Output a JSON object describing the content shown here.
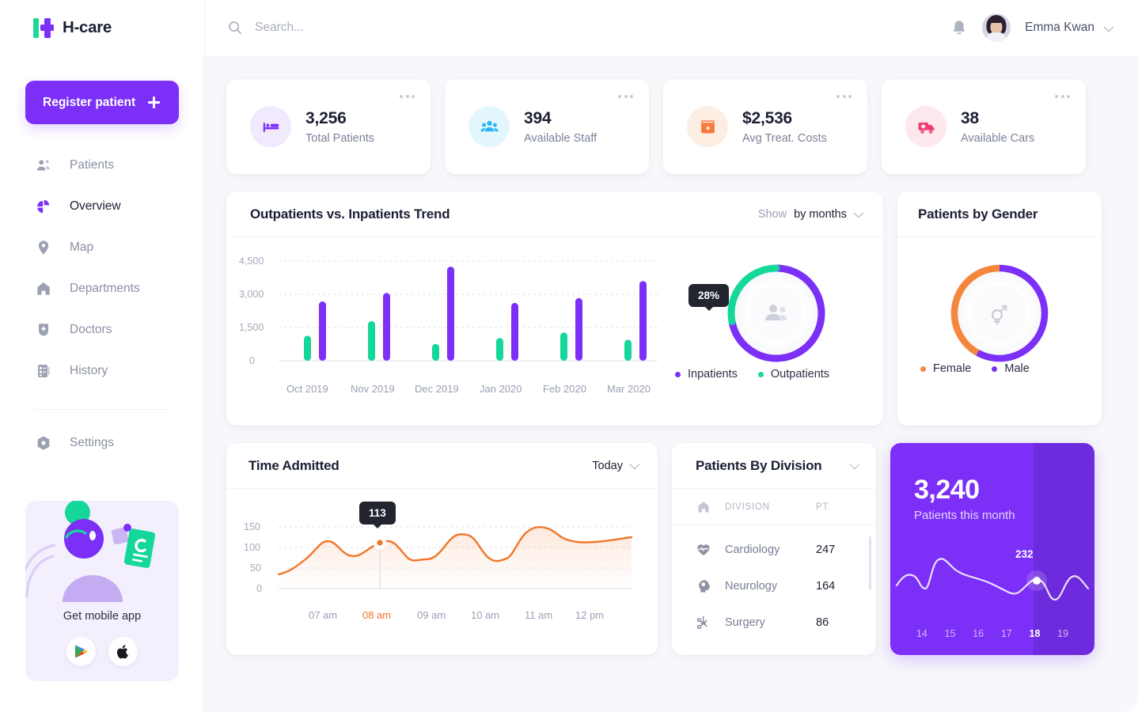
{
  "brand": {
    "name": "H-care",
    "logo_icon": "hcare-logo-icon"
  },
  "search": {
    "placeholder": "Search...",
    "value": "",
    "icon": "search-icon"
  },
  "header": {
    "notification_icon": "bell-icon",
    "user_name": "Emma Kwan",
    "avatar_icon": "user-avatar",
    "chevron_icon": "chevron-down-icon"
  },
  "sidebar": {
    "register_label": "Register patient",
    "register_icon": "plus-icon",
    "items": [
      {
        "label": "Patients",
        "icon": "people-icon",
        "active": false
      },
      {
        "label": "Overview",
        "icon": "pie-chart-icon",
        "active": true
      },
      {
        "label": "Map",
        "icon": "location-pin-icon",
        "active": false
      },
      {
        "label": "Departments",
        "icon": "home-icon",
        "active": false
      },
      {
        "label": "Doctors",
        "icon": "doctor-badge-icon",
        "active": false
      },
      {
        "label": "History",
        "icon": "history-list-icon",
        "active": false
      }
    ],
    "settings": {
      "label": "Settings",
      "icon": "settings-gear-icon"
    },
    "promo": {
      "title": "Get mobile app",
      "google_play_icon": "google-play-icon",
      "apple_icon": "apple-icon"
    }
  },
  "stats": [
    {
      "value": "3,256",
      "label": "Total Patients",
      "icon": "hospital-bed-icon",
      "icon_color": "#7B2FF7",
      "bg_color": "#f1e9fe",
      "menu_icon": "more-icon"
    },
    {
      "value": "394",
      "label": "Available Staff",
      "icon": "group-people-icon",
      "icon_color": "#29B6F6",
      "bg_color": "#e4f6fd",
      "menu_icon": "more-icon"
    },
    {
      "value": "$2,536",
      "label": "Avg Treat. Costs",
      "icon": "wallet-icon",
      "icon_color": "#F97A3D",
      "bg_color": "#fdeee3",
      "menu_icon": "more-icon"
    },
    {
      "value": "38",
      "label": "Available Cars",
      "icon": "ambulance-icon",
      "icon_color": "#F23E6E",
      "bg_color": "#fde8ee",
      "menu_icon": "more-icon"
    }
  ],
  "trend": {
    "title": "Outpatients vs. Inpatients Trend",
    "filter_muted": "Show",
    "filter_strong": "by months",
    "filter_icon": "chevron-down-icon",
    "donut_label": "28%",
    "donut_center_icon": "people-icon",
    "legend": [
      {
        "label": "Inpatients",
        "color": "#7B2FF7"
      },
      {
        "label": "Outpatients",
        "color": "#16D79A"
      }
    ]
  },
  "gender": {
    "title": "Patients by Gender",
    "center_icon": "gender-symbol-icon",
    "legend": [
      {
        "label": "Female",
        "color": "#F5873C"
      },
      {
        "label": "Male",
        "color": "#7B2FF7"
      }
    ]
  },
  "time_admitted": {
    "title": "Time Admitted",
    "filter_label": "Today",
    "filter_icon": "chevron-down-icon",
    "tooltip": "113"
  },
  "division": {
    "title": "Patients By Division",
    "collapse_icon": "chevron-down-icon",
    "header_icon": "home-icon",
    "columns": [
      "DIVISION",
      "PT."
    ],
    "rows": [
      {
        "name": "Cardiology",
        "pt": "247",
        "icon": "heart-pulse-icon"
      },
      {
        "name": "Neurology",
        "pt": "164",
        "icon": "brain-head-icon"
      },
      {
        "name": "Surgery",
        "pt": "86",
        "icon": "scissors-icon"
      }
    ]
  },
  "month_card": {
    "value": "3,240",
    "label": "Patients this month",
    "tooltip": "232",
    "days": [
      "14",
      "15",
      "16",
      "17",
      "18",
      "19"
    ],
    "active_day": "18",
    "bg_color": "#7B2FF7"
  },
  "chart_data": [
    {
      "type": "bar",
      "title": "Outpatients vs. Inpatients Trend",
      "categories": [
        "Oct 2019",
        "Nov 2019",
        "Dec 2019",
        "Jan 2020",
        "Feb 2020",
        "Mar 2020"
      ],
      "series": [
        {
          "name": "Outpatients",
          "color": "#16D79A",
          "values": [
            1130,
            1790,
            760,
            1030,
            1280,
            950
          ]
        },
        {
          "name": "Inpatients",
          "color": "#7B2FF7",
          "values": [
            2680,
            3060,
            4250,
            2610,
            2830,
            3600
          ]
        }
      ],
      "yticks": [
        "0",
        "1,500",
        "3,000",
        "4,500"
      ],
      "ylim": [
        0,
        4500
      ],
      "xlabel": "",
      "ylabel": "",
      "grid": true,
      "legend_position": "bottom"
    },
    {
      "type": "pie",
      "title": "Outpatients vs. Inpatients share",
      "labels": [
        "Inpatients",
        "Outpatients"
      ],
      "values": [
        72,
        28
      ],
      "colors": [
        "#7B2FF7",
        "#16D79A"
      ],
      "annotation": "28%",
      "legend_position": "bottom"
    },
    {
      "type": "pie",
      "title": "Patients by Gender",
      "labels": [
        "Female",
        "Male"
      ],
      "values": [
        42,
        58
      ],
      "colors": [
        "#F5873C",
        "#7B2FF7"
      ],
      "legend_position": "bottom"
    },
    {
      "type": "area",
      "title": "Time Admitted",
      "x": [
        "07 am",
        "08 am",
        "09 am",
        "10 am",
        "11 am",
        "12 pm"
      ],
      "series": [
        {
          "name": "Admitted",
          "color": "#F2752A",
          "values": [
            110,
            113,
            70,
            132,
            143,
            120
          ]
        }
      ],
      "yticks": [
        "0",
        "50",
        "100",
        "150"
      ],
      "ylim": [
        0,
        175
      ],
      "annotation": "113",
      "highlight_x": "08 am",
      "grid": true,
      "legend_position": "none"
    },
    {
      "type": "line",
      "title": "Patients this month",
      "x": [
        "14",
        "15",
        "16",
        "17",
        "18",
        "19"
      ],
      "series": [
        {
          "name": "Patients",
          "color": "#FFFFFF",
          "values": [
            218,
            255,
            240,
            205,
            232,
            245
          ]
        }
      ],
      "annotation": "232",
      "highlight_x": "18",
      "grid": false,
      "legend_position": "none"
    },
    {
      "type": "table",
      "title": "Patients By Division",
      "columns": [
        "DIVISION",
        "PT."
      ],
      "rows": [
        [
          "Cardiology",
          "247"
        ],
        [
          "Neurology",
          "164"
        ],
        [
          "Surgery",
          "86"
        ]
      ]
    }
  ]
}
